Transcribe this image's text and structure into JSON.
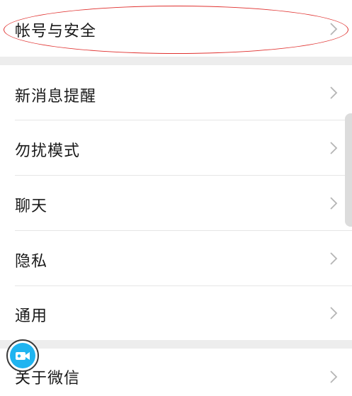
{
  "settings": {
    "account_security": "帐号与安全",
    "items": [
      {
        "label": "新消息提醒"
      },
      {
        "label": "勿扰模式"
      },
      {
        "label": "聊天"
      },
      {
        "label": "隐私"
      },
      {
        "label": "通用"
      }
    ],
    "about": "关于微信"
  },
  "colors": {
    "background": "#ededed",
    "row_background": "#ffffff",
    "text": "#1a1a1a",
    "chevron": "#b5b5b5",
    "highlight": "#e0312f",
    "floating_button": "#1fb4f0"
  },
  "icons": {
    "chevron": "chevron-right-icon",
    "floating": "video-camera-icon"
  }
}
